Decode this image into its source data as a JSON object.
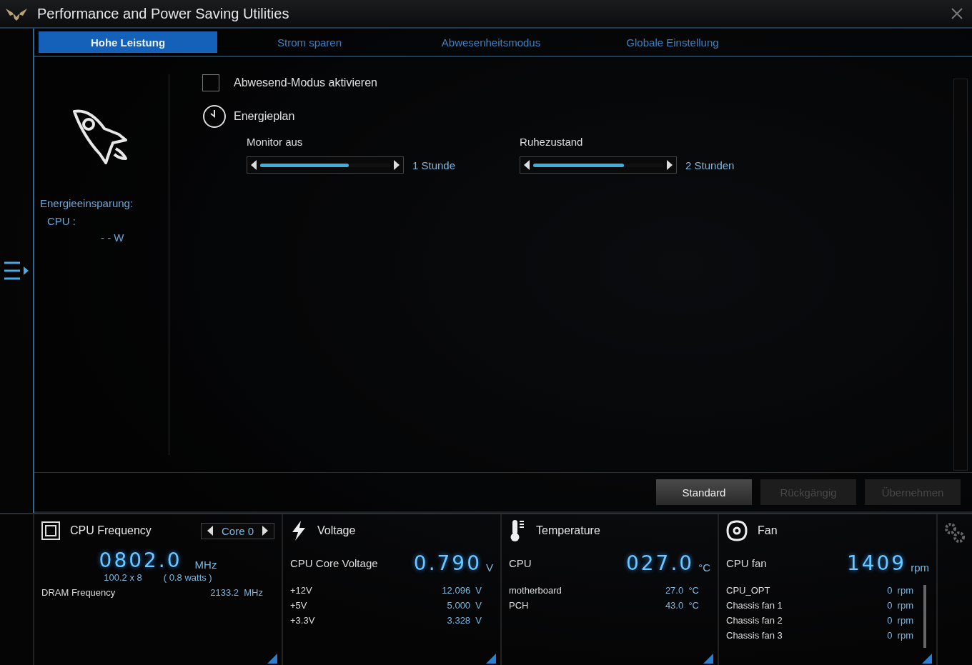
{
  "window": {
    "title": "Performance and Power Saving Utilities"
  },
  "tabs": [
    {
      "label": "Hohe Leistung",
      "selected": true
    },
    {
      "label": "Strom sparen",
      "selected": false
    },
    {
      "label": "Abwesenheitsmodus",
      "selected": false
    },
    {
      "label": "Globale Einstellung",
      "selected": false
    }
  ],
  "side_panel": {
    "heading": "Energieeinsparung:",
    "cpu_label": "CPU :",
    "cpu_value": "- - W"
  },
  "away_mode": {
    "label": "Abwesend-Modus aktivieren",
    "checked": false
  },
  "power_plan": {
    "title": "Energieplan",
    "sliders": [
      {
        "label": "Monitor aus",
        "level": 0.68,
        "reading": "1 Stunde"
      },
      {
        "label": "Ruhezustand",
        "level": 0.7,
        "reading": "2 Stunden"
      }
    ]
  },
  "buttons": [
    {
      "label": "Standard",
      "disabled": false
    },
    {
      "label": "Rückgängig",
      "disabled": true
    },
    {
      "label": "Übernehmen",
      "disabled": true
    }
  ],
  "monitors": [
    {
      "kind": "frequency",
      "title": "CPU Frequency",
      "selector": "Core 0",
      "value": "0802.0",
      "unit": "MHz",
      "ratio": "100.2  x  8",
      "power": "( 0.8   watts )",
      "rows": [
        {
          "name": "DRAM Frequency",
          "value": "2133.2",
          "unit": "MHz"
        }
      ]
    },
    {
      "kind": "voltage",
      "title": "Voltage",
      "main_label": "CPU Core Voltage",
      "value": "0.790",
      "unit": "V",
      "rows": [
        {
          "name": "+12V",
          "value": "12.096",
          "unit": "V"
        },
        {
          "name": "+5V",
          "value": "5.000",
          "unit": "V"
        },
        {
          "name": "+3.3V",
          "value": "3.328",
          "unit": "V"
        }
      ]
    },
    {
      "kind": "temperature",
      "title": "Temperature",
      "main_label": "CPU",
      "value": "027.0",
      "unit": "°C",
      "rows": [
        {
          "name": "motherboard",
          "value": "27.0",
          "unit": "°C"
        },
        {
          "name": "PCH",
          "value": "43.0",
          "unit": "°C"
        }
      ]
    },
    {
      "kind": "fan",
      "title": "Fan",
      "main_label": "CPU fan",
      "value": "1409",
      "unit": "rpm",
      "rows": [
        {
          "name": "CPU_OPT",
          "value": "0",
          "unit": "rpm"
        },
        {
          "name": "Chassis fan 1",
          "value": "0",
          "unit": "rpm"
        },
        {
          "name": "Chassis fan 2",
          "value": "0",
          "unit": "rpm"
        },
        {
          "name": "Chassis fan 3",
          "value": "0",
          "unit": "rpm"
        }
      ]
    }
  ]
}
